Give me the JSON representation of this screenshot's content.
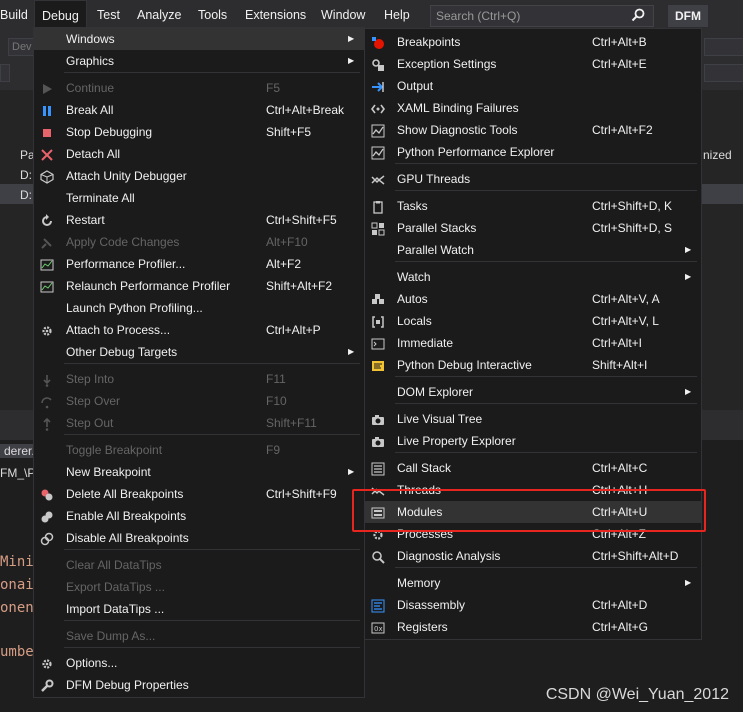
{
  "menubar": {
    "items": [
      "Build",
      "Debug",
      "Test",
      "Analyze",
      "Tools",
      "Extensions",
      "Window",
      "Help"
    ],
    "search_placeholder": "Search (Ctrl+Q)",
    "badge": "DFM"
  },
  "background": {
    "toolbar_text": "Dev",
    "panel_header": "Pa",
    "panel_header_right": "nized",
    "rows": [
      "D:",
      "D:"
    ],
    "tab1": "derer.h",
    "tab2": "FM_\\P",
    "code_lines": [
      "Mini",
      "onai",
      "onent",
      "umbe"
    ]
  },
  "debug_menu": {
    "title": "Debug",
    "items": [
      {
        "label": "Windows",
        "shortcut": "",
        "submenu": true,
        "icon": "",
        "disabled": false,
        "highlight": true
      },
      {
        "label": "Graphics",
        "shortcut": "",
        "submenu": true,
        "icon": "",
        "disabled": false
      },
      {
        "label": "Continue",
        "shortcut": "F5",
        "icon": "play-icon",
        "disabled": true
      },
      {
        "label": "Break All",
        "shortcut": "Ctrl+Alt+Break",
        "icon": "pause-icon",
        "disabled": false
      },
      {
        "label": "Stop Debugging",
        "shortcut": "Shift+F5",
        "icon": "stop-icon",
        "disabled": false
      },
      {
        "label": "Detach All",
        "shortcut": "",
        "icon": "x-icon",
        "disabled": false
      },
      {
        "label": "Attach Unity Debugger",
        "shortcut": "",
        "icon": "unity-icon",
        "disabled": false
      },
      {
        "label": "Terminate All",
        "shortcut": "",
        "icon": "",
        "disabled": false
      },
      {
        "label": "Restart",
        "shortcut": "Ctrl+Shift+F5",
        "icon": "restart-icon",
        "disabled": false
      },
      {
        "label": "Apply Code Changes",
        "shortcut": "Alt+F10",
        "icon": "apply-changes-icon",
        "disabled": true
      },
      {
        "label": "Performance Profiler...",
        "shortcut": "Alt+F2",
        "icon": "profiler-icon",
        "disabled": false
      },
      {
        "label": "Relaunch Performance Profiler",
        "shortcut": "Shift+Alt+F2",
        "icon": "profiler-icon",
        "disabled": false
      },
      {
        "label": "Launch Python Profiling...",
        "shortcut": "",
        "icon": "",
        "disabled": false
      },
      {
        "label": "Attach to Process...",
        "shortcut": "Ctrl+Alt+P",
        "icon": "gear-icon",
        "disabled": false
      },
      {
        "label": "Other Debug Targets",
        "shortcut": "",
        "submenu": true,
        "icon": "",
        "disabled": false
      },
      {
        "label": "Step Into",
        "shortcut": "F11",
        "icon": "step-into-icon",
        "disabled": true
      },
      {
        "label": "Step Over",
        "shortcut": "F10",
        "icon": "step-over-icon",
        "disabled": true
      },
      {
        "label": "Step Out",
        "shortcut": "Shift+F11",
        "icon": "step-out-icon",
        "disabled": true
      },
      {
        "label": "Toggle Breakpoint",
        "shortcut": "F9",
        "icon": "",
        "disabled": true
      },
      {
        "label": "New Breakpoint",
        "shortcut": "",
        "submenu": true,
        "icon": "",
        "disabled": false
      },
      {
        "label": "Delete All Breakpoints",
        "shortcut": "Ctrl+Shift+F9",
        "icon": "delete-breakpoints-icon",
        "disabled": false
      },
      {
        "label": "Enable All Breakpoints",
        "shortcut": "",
        "icon": "enable-breakpoints-icon",
        "disabled": false
      },
      {
        "label": "Disable All Breakpoints",
        "shortcut": "",
        "icon": "disable-breakpoints-icon",
        "disabled": false
      },
      {
        "label": "Clear All DataTips",
        "shortcut": "",
        "icon": "",
        "disabled": true
      },
      {
        "label": "Export DataTips ...",
        "shortcut": "",
        "icon": "",
        "disabled": true
      },
      {
        "label": "Import DataTips ...",
        "shortcut": "",
        "icon": "",
        "disabled": false
      },
      {
        "label": "Save Dump As...",
        "shortcut": "",
        "icon": "",
        "disabled": true
      },
      {
        "label": "Options...",
        "shortcut": "",
        "icon": "gear-icon",
        "disabled": false
      },
      {
        "label": "DFM Debug Properties",
        "shortcut": "",
        "icon": "wrench-icon",
        "disabled": false
      }
    ]
  },
  "windows_menu": {
    "items": [
      {
        "label": "Breakpoints",
        "shortcut": "Ctrl+Alt+B",
        "icon": "breakpoint-icon"
      },
      {
        "label": "Exception Settings",
        "shortcut": "Ctrl+Alt+E",
        "icon": "exception-icon"
      },
      {
        "label": "Output",
        "shortcut": "",
        "icon": "output-icon"
      },
      {
        "label": "XAML Binding Failures",
        "shortcut": "",
        "icon": "xaml-icon"
      },
      {
        "label": "Show Diagnostic Tools",
        "shortcut": "Ctrl+Alt+F2",
        "icon": "diagnostic-icon"
      },
      {
        "label": "Python Performance Explorer",
        "shortcut": "",
        "icon": "diagnostic-icon"
      },
      {
        "label": "GPU Threads",
        "shortcut": "",
        "icon": "gpu-icon"
      },
      {
        "label": "Tasks",
        "shortcut": "Ctrl+Shift+D, K",
        "icon": "tasks-icon"
      },
      {
        "label": "Parallel Stacks",
        "shortcut": "Ctrl+Shift+D, S",
        "icon": "parallel-stacks-icon"
      },
      {
        "label": "Parallel Watch",
        "shortcut": "",
        "submenu": true,
        "icon": ""
      },
      {
        "label": "Watch",
        "shortcut": "",
        "submenu": true,
        "icon": ""
      },
      {
        "label": "Autos",
        "shortcut": "Ctrl+Alt+V, A",
        "icon": "autos-icon"
      },
      {
        "label": "Locals",
        "shortcut": "Ctrl+Alt+V, L",
        "icon": "locals-icon"
      },
      {
        "label": "Immediate",
        "shortcut": "Ctrl+Alt+I",
        "icon": "immediate-icon"
      },
      {
        "label": "Python Debug Interactive",
        "shortcut": "Shift+Alt+I",
        "icon": "python-interactive-icon"
      },
      {
        "label": "DOM Explorer",
        "shortcut": "",
        "submenu": true,
        "icon": ""
      },
      {
        "label": "Live Visual Tree",
        "shortcut": "",
        "icon": "camera-icon"
      },
      {
        "label": "Live Property Explorer",
        "shortcut": "",
        "icon": "camera-icon"
      },
      {
        "label": "Call Stack",
        "shortcut": "Ctrl+Alt+C",
        "icon": "call-stack-icon"
      },
      {
        "label": "Threads",
        "shortcut": "Ctrl+Alt+H",
        "icon": "threads-icon"
      },
      {
        "label": "Modules",
        "shortcut": "Ctrl+Alt+U",
        "icon": "modules-icon",
        "highlight": true
      },
      {
        "label": "Processes",
        "shortcut": "Ctrl+Alt+Z",
        "icon": "processes-icon"
      },
      {
        "label": "Diagnostic Analysis",
        "shortcut": "Ctrl+Shift+Alt+D",
        "icon": "diagnostic-analysis-icon"
      },
      {
        "label": "Memory",
        "shortcut": "",
        "submenu": true,
        "icon": ""
      },
      {
        "label": "Disassembly",
        "shortcut": "Ctrl+Alt+D",
        "icon": "disassembly-icon"
      },
      {
        "label": "Registers",
        "shortcut": "Ctrl+Alt+G",
        "icon": "registers-icon"
      }
    ]
  },
  "colors": {
    "highlight_box": "#e8251f",
    "menu_bg": "#1b1b1c",
    "disabled_text": "#656565"
  },
  "watermark": "CSDN @Wei_Yuan_2012"
}
